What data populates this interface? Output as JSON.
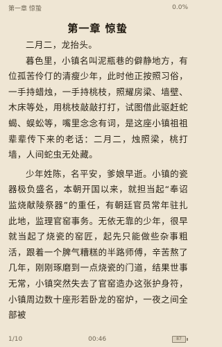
{
  "header": {
    "running_title": "第一章 惊蛰",
    "progress": "0.0%"
  },
  "chapter_title": "第一章 惊蛰",
  "paragraphs": [
    "二月二，龙抬头。",
    "暮色里，小镇名叫泥瓶巷的僻静地方，有位孤苦伶仃的清瘦少年，此时他正按照习俗，一手持蜡烛，一手持桃枝，照耀房梁、墙壁、木床等处，用桃枝敲敲打打，试图借此驱赶蛇蝎、蜈蚣等，嘴里念念有词，是这座小镇祖祖辈辈传下来的老话：二月二，烛照梁，桃打墙，人间蛇虫无处藏。",
    "少年姓陈，名平安，爹娘早逝。小镇的瓷器极负盛名，本朝开国以来，就担当起“奉诏监烧献陵祭器”的重任，有朝廷官员常年驻扎此地，监理官窑事务。无依无靠的少年，很早就当起了烧瓷的窑匠，起先只能做些杂事粗活，跟着一个脾气糟糕的半路师傅，辛苦熬了几年，刚刚琢磨到一点烧瓷的门道，结果世事无常，小镇突然失去了官窑造办这张护身符，小镇周边数十座形若卧龙的窑炉，一夜之间全部被"
  ],
  "footer": {
    "page": "1/10",
    "time": "00:46",
    "battery": "87"
  }
}
